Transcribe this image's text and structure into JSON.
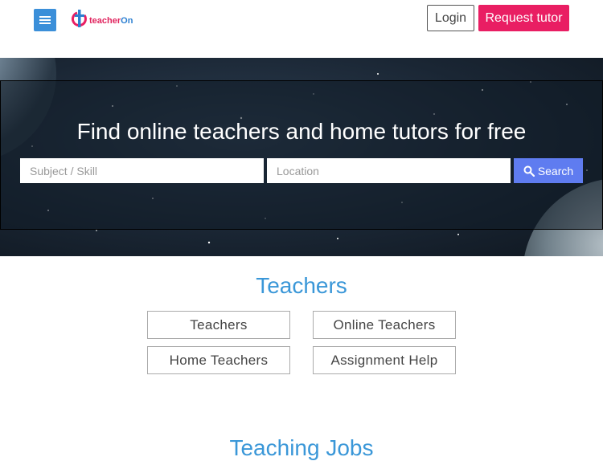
{
  "header": {
    "logo_text_main": "teacher",
    "logo_text_accent": "On",
    "login_label": "Login",
    "request_label": "Request tutor"
  },
  "hero": {
    "title": "Find online teachers and home tutors for free",
    "subject_placeholder": "Subject / Skill",
    "location_placeholder": "Location",
    "search_label": "Search"
  },
  "teachers_section": {
    "title": "Teachers",
    "links": [
      "Teachers",
      "Online Teachers",
      "Home Teachers",
      "Assignment Help"
    ]
  },
  "jobs_section": {
    "title": "Teaching Jobs"
  },
  "colors": {
    "brand_pink": "#e91e63",
    "brand_blue": "#3b8fd9",
    "search_button": "#5f7cf0",
    "section_title": "#3a97d8"
  },
  "icons": {
    "menu": "hamburger-menu-icon",
    "search": "search-icon",
    "logo": "teacheron-logo-icon"
  }
}
